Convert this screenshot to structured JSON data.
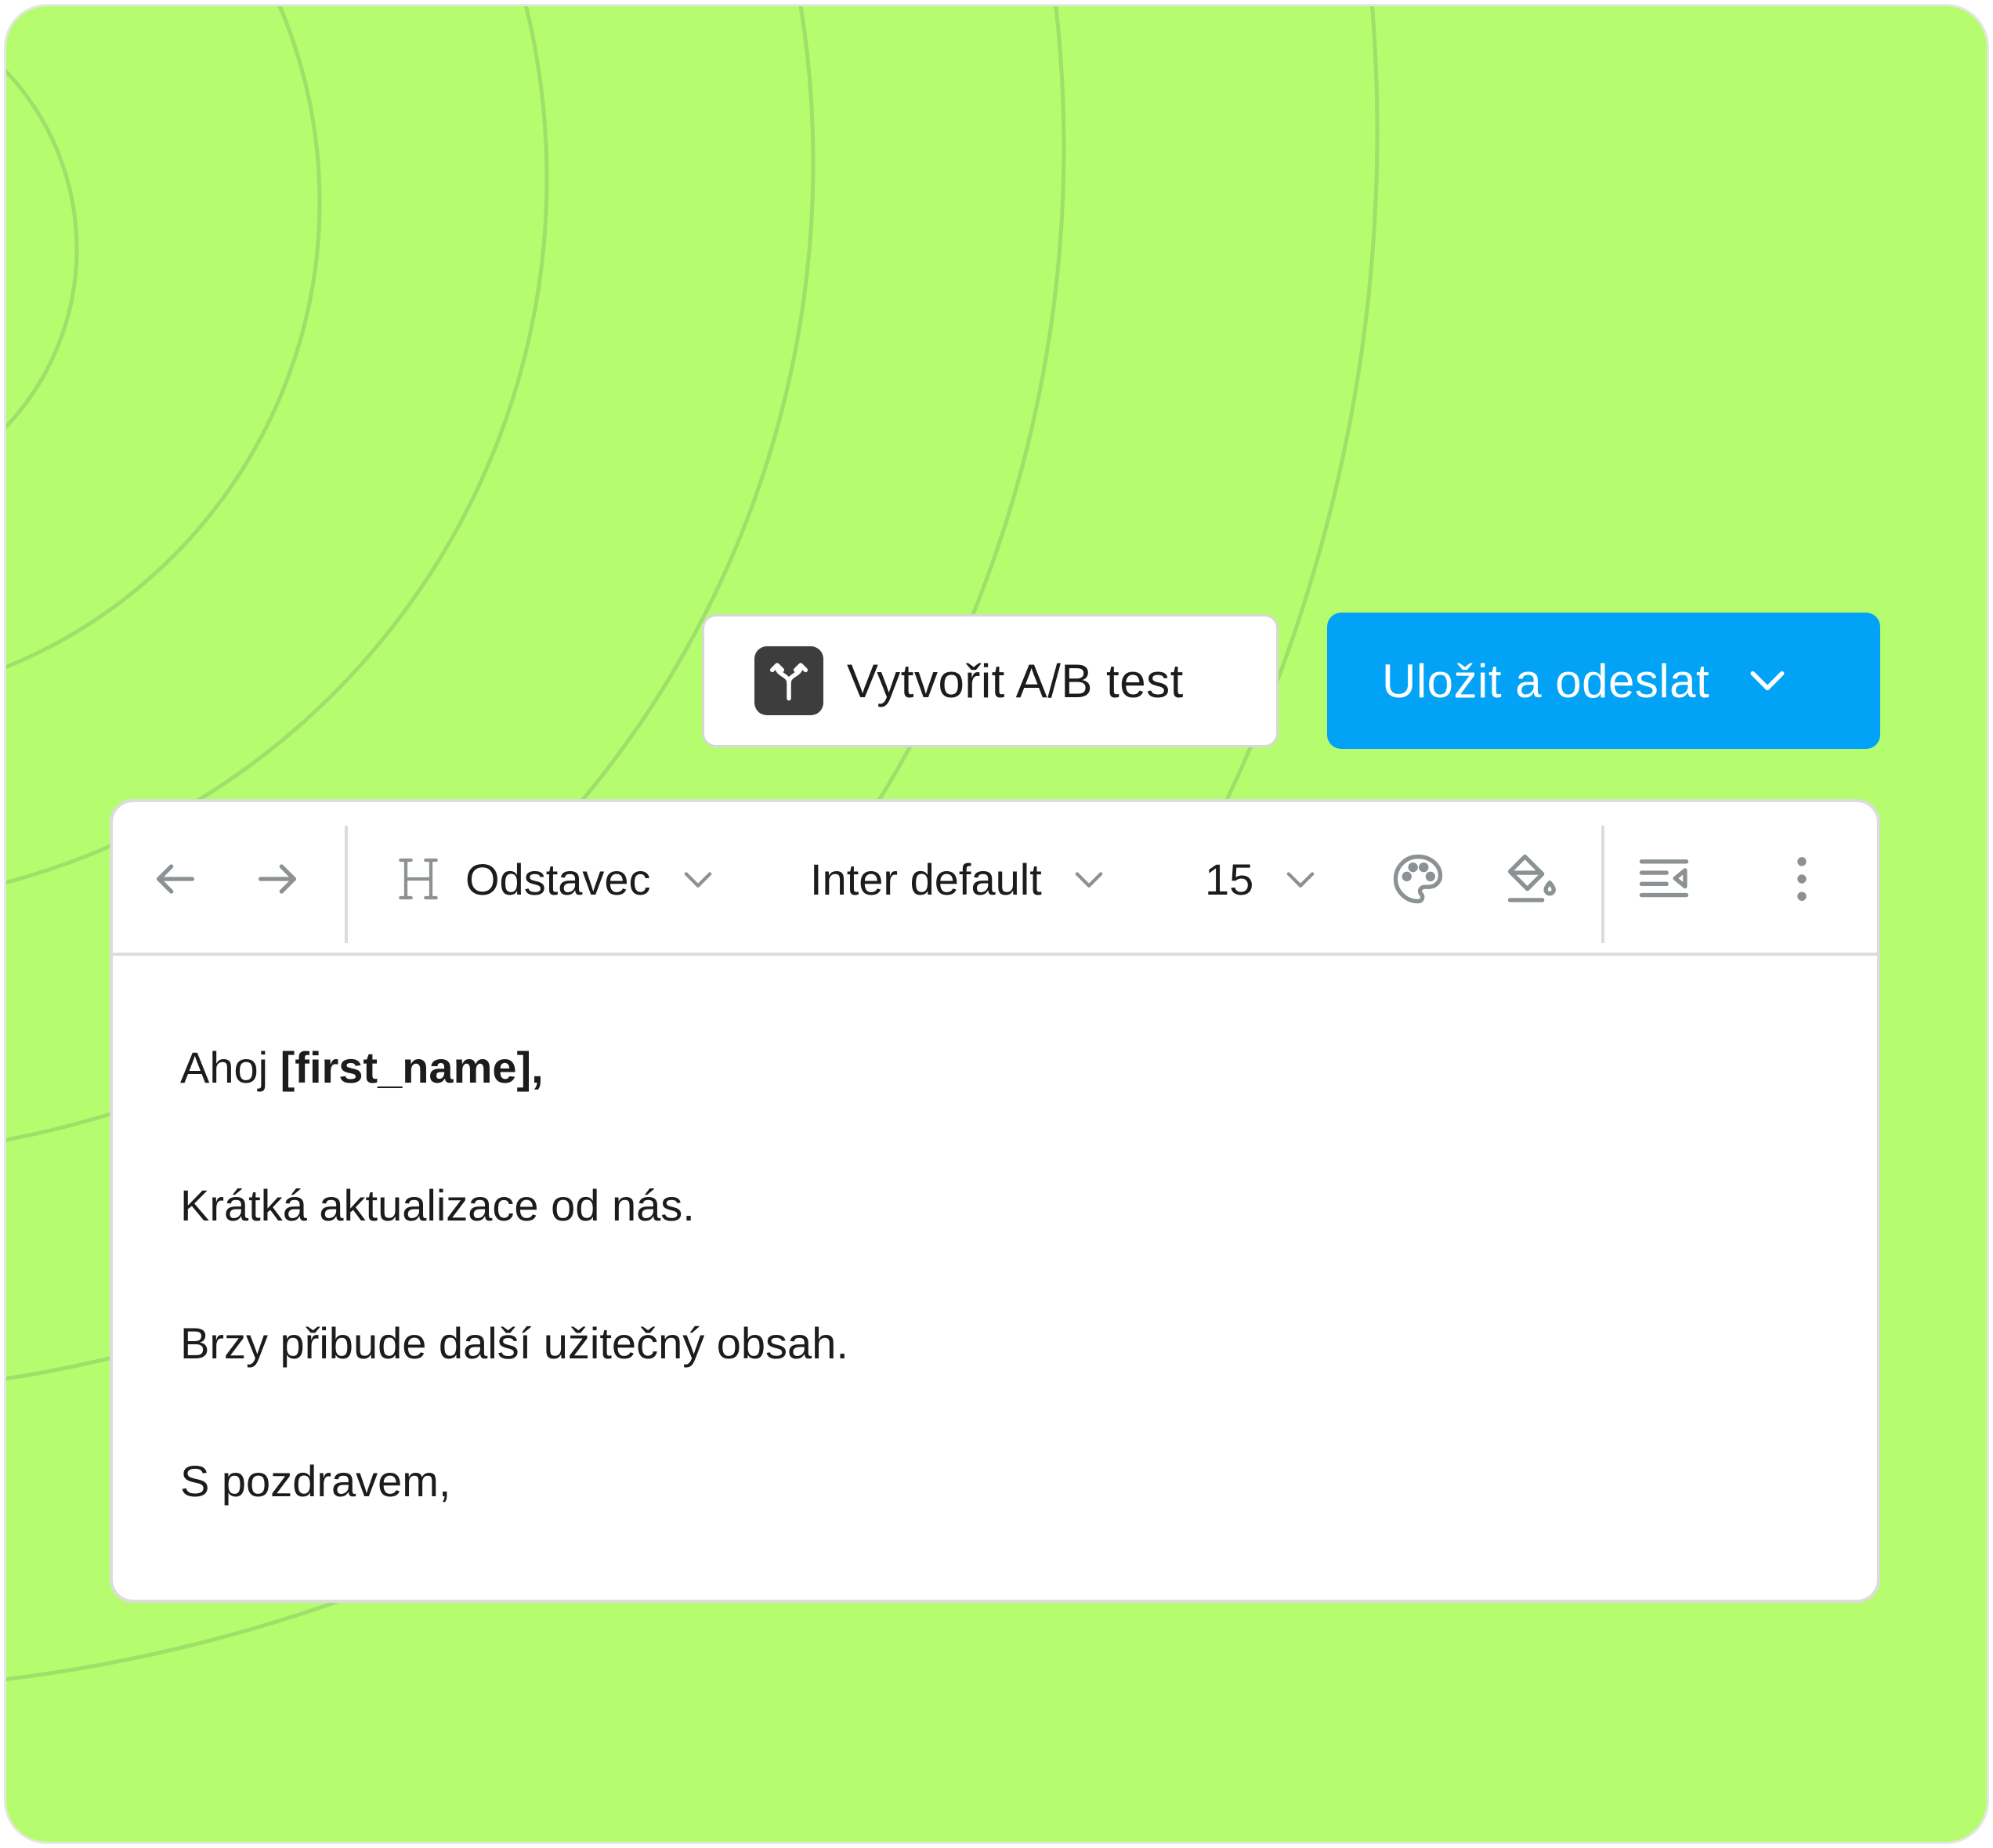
{
  "actions": {
    "ab_test_label": "Vytvořit A/B test",
    "ab_test_icon": "split-arrows-icon",
    "send_label": "Uložit a odeslat",
    "send_dropdown_icon": "chevron-down-icon"
  },
  "toolbar": {
    "undo_icon": "arrow-left-icon",
    "redo_icon": "arrow-right-icon",
    "heading_icon": "heading-icon",
    "block_type": "Odstavec",
    "font_family": "Inter default",
    "font_size": "15",
    "text_color_icon": "palette-icon",
    "fill_color_icon": "paint-bucket-icon",
    "direction_icon": "text-direction-icon",
    "more_icon": "more-vertical-icon"
  },
  "content": {
    "greeting_prefix": "Ahoj ",
    "greeting_variable": "[first_name],",
    "line2": "Krátká aktualizace od nás.",
    "line3": "Brzy přibude další užitečný obsah.",
    "line4": "S pozdravem,"
  },
  "colors": {
    "background": "#b5fd6e",
    "primary": "#02a3f7",
    "icon_gray": "#8c9194"
  }
}
